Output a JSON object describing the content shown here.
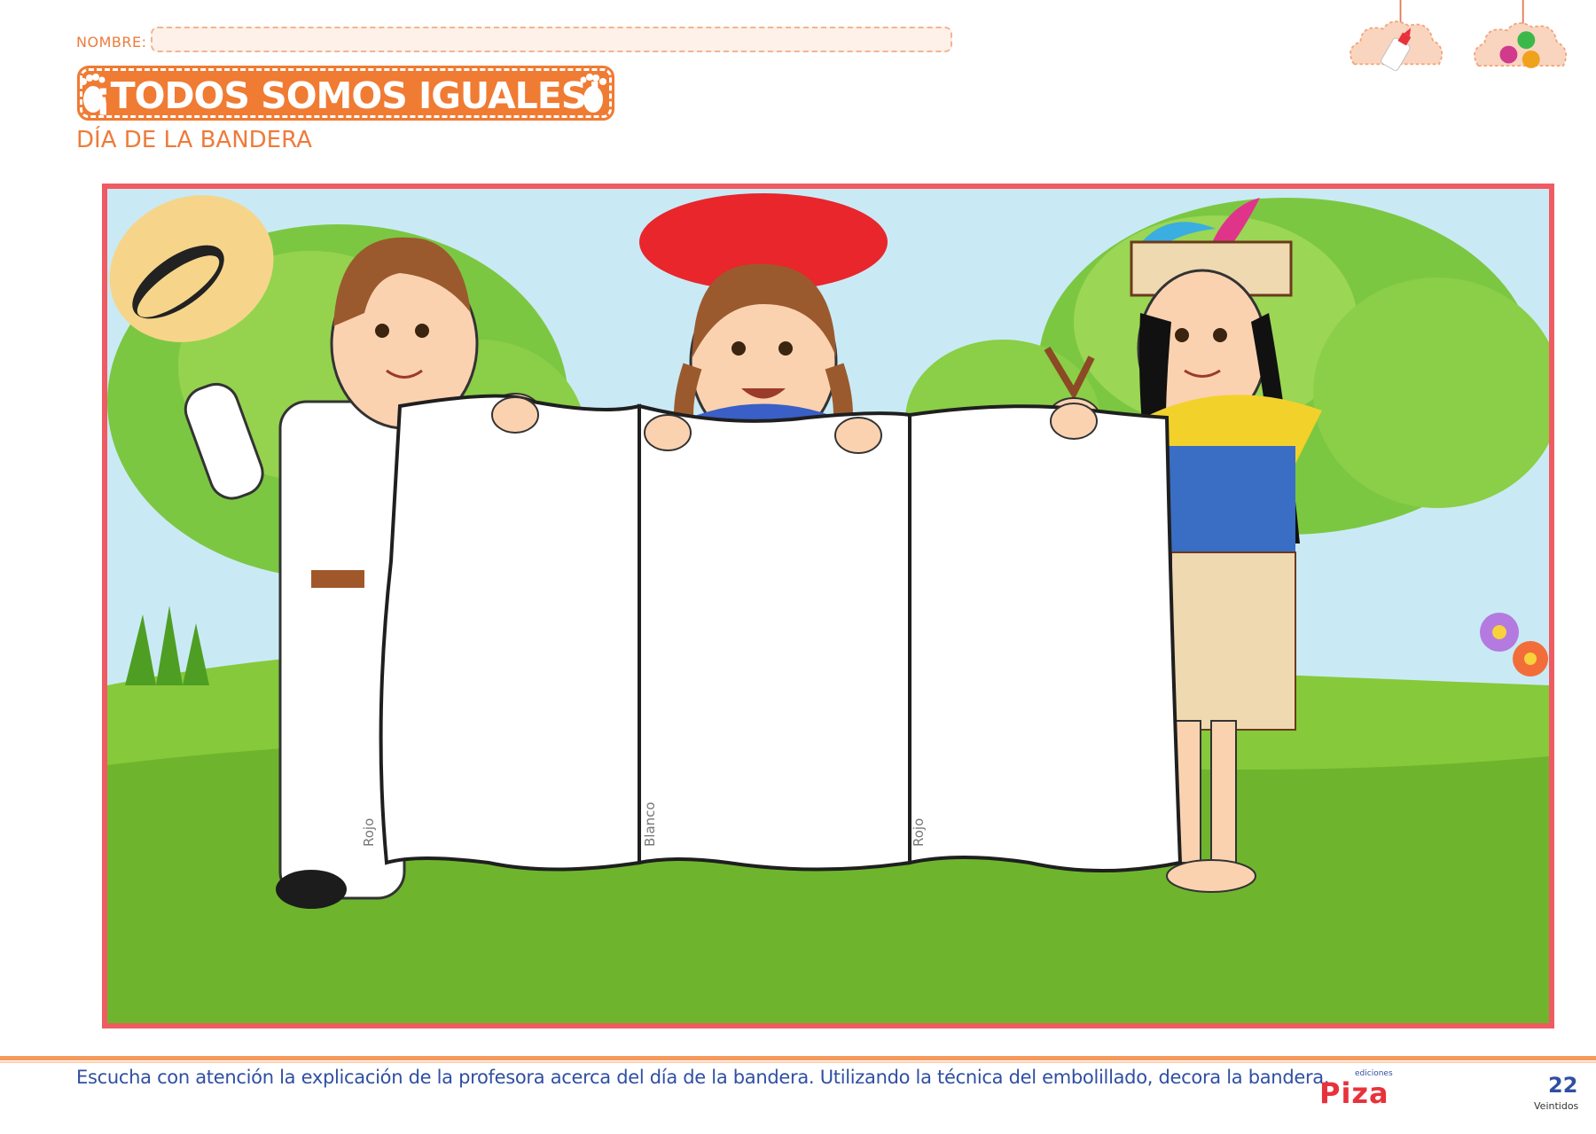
{
  "header": {
    "name_label": "NOMBRE:",
    "title": "¡TODOS SOMOS IGUALES!",
    "subtitle": "DÍA DE LA BANDERA"
  },
  "flag": {
    "stripes": [
      {
        "label": "Rojo"
      },
      {
        "label": "Blanco"
      },
      {
        "label": "Rojo"
      }
    ]
  },
  "footer": {
    "instruction": "Escucha con atención la explicación de la profesora acerca del día de la bandera. Utilizando la técnica del embolillado, decora la bandera.",
    "publisher_small": "ediciones",
    "publisher_name": "Piza",
    "page_number": "22",
    "page_word": "Veintidos"
  },
  "colors": {
    "accent": "#f07b33",
    "frame": "#ef5b62",
    "text_blue": "#2f4fa3"
  },
  "icons": [
    "glue-bottle-icon",
    "paint-balls-icon",
    "footprint-icon"
  ]
}
